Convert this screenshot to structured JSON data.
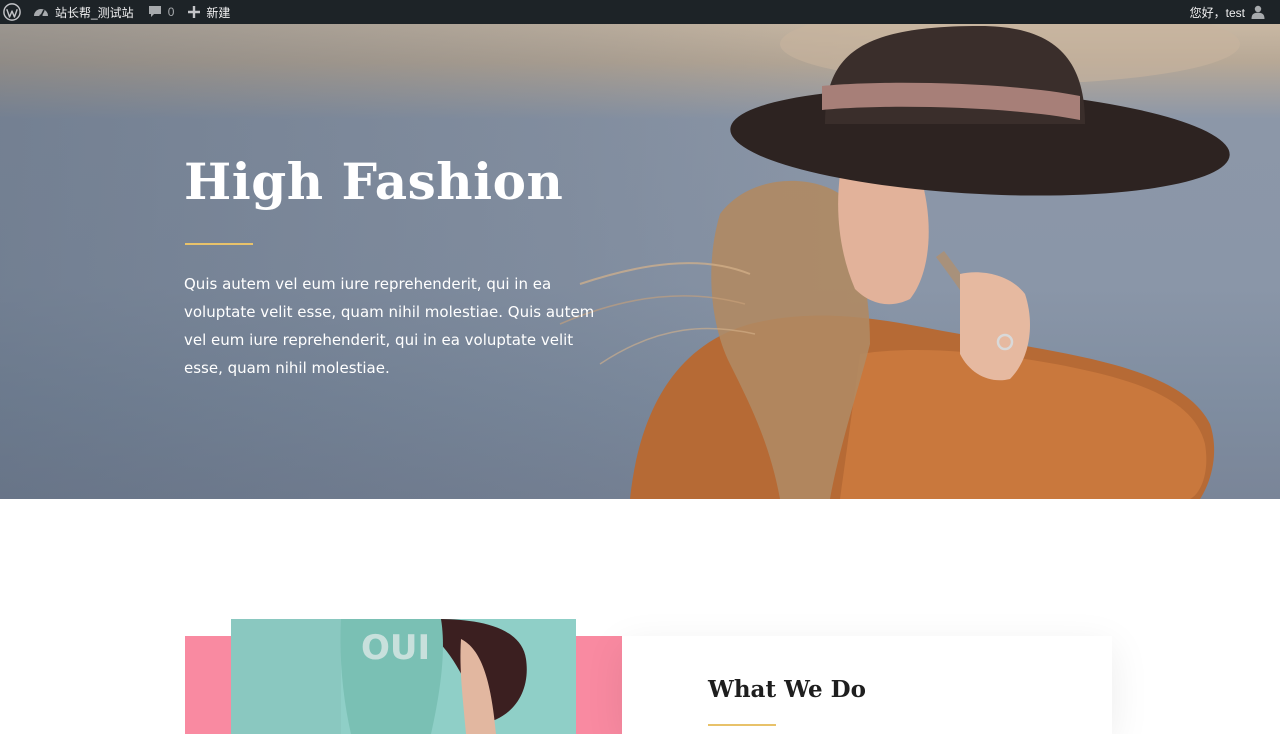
{
  "admin_bar": {
    "site_name": "站长帮_测试站",
    "comments_count": "0",
    "new_label": "新建",
    "greeting": "您好，test"
  },
  "hero": {
    "title": "High Fashion",
    "body": "Quis autem vel eum iure reprehenderit, qui in ea voluptate velit esse, quam nihil molestiae. Quis autem vel eum iure reprehenderit, qui in ea voluptate velit esse, quam nihil molestiae."
  },
  "section": {
    "heading": "What We Do"
  },
  "colors": {
    "accent_gold": "#e8c26a",
    "accent_pink": "#f98aa1",
    "admin_bar_bg": "#1d2327"
  }
}
